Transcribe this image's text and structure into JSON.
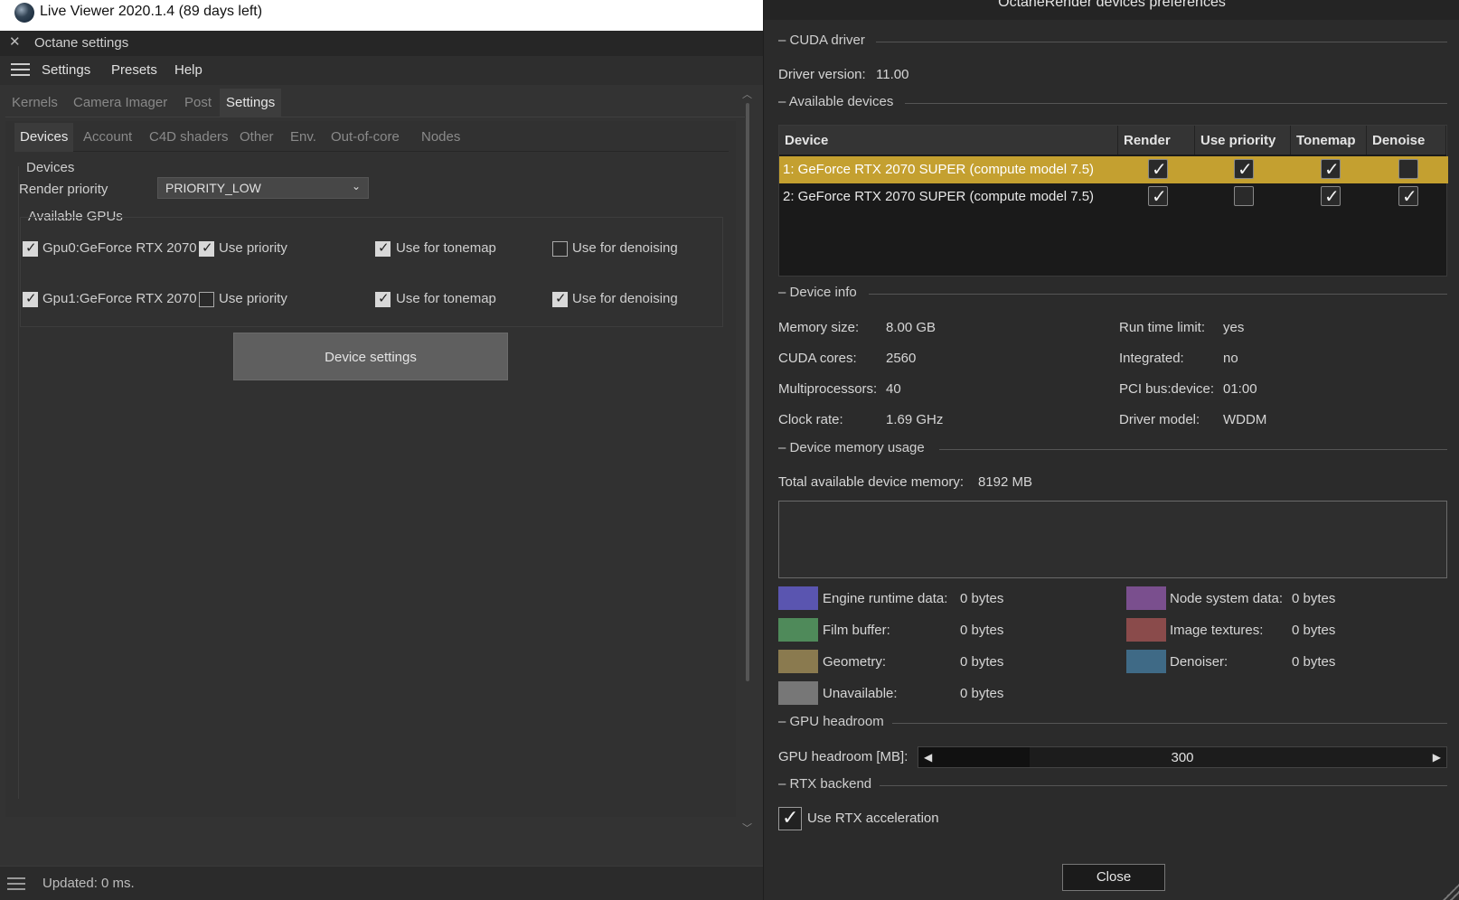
{
  "left": {
    "window_title": "Live Viewer 2020.1.4 (89 days left)",
    "panel_title": "Octane settings",
    "menu": [
      "Settings",
      "Presets",
      "Help"
    ],
    "tabs": [
      "Kernels",
      "Camera Imager",
      "Post",
      "Settings"
    ],
    "active_tab": "Settings",
    "subtabs": [
      "Devices",
      "Account",
      "C4D shaders",
      "Other",
      "Env.",
      "Out-of-core",
      "Nodes"
    ],
    "active_subtab": "Devices",
    "devices_group": "Devices",
    "render_priority_label": "Render priority",
    "render_priority_value": "PRIORITY_LOW",
    "available_gpus_label": "Available GPUs",
    "gpus": [
      {
        "name": "Gpu0:GeForce RTX 2070",
        "enabled": true,
        "use_priority": true,
        "tonemap": true,
        "denoising": false
      },
      {
        "name": "Gpu1:GeForce RTX 2070 :",
        "enabled": true,
        "use_priority": false,
        "tonemap": true,
        "denoising": true
      }
    ],
    "use_priority_label": "Use priority",
    "tonemap_label": "Use for tonemap",
    "denoising_label": "Use for denoising",
    "device_settings_button": "Device settings",
    "status": "Updated: 0 ms."
  },
  "right": {
    "title": "OctaneRender devices preferences",
    "cuda_driver_section": "CUDA driver",
    "driver_version_label": "Driver version:",
    "driver_version": "11.00",
    "available_devices_section": "Available devices",
    "table_headers": [
      "Device",
      "Render",
      "Use priority",
      "Tonemap",
      "Denoise"
    ],
    "devices": [
      {
        "name": "1: GeForce RTX 2070 SUPER (compute model 7.5)",
        "render": true,
        "priority": true,
        "tonemap": true,
        "denoise": false,
        "selected": true
      },
      {
        "name": "2: GeForce RTX 2070 SUPER (compute model 7.5)",
        "render": true,
        "priority": false,
        "tonemap": true,
        "denoise": true,
        "selected": false
      }
    ],
    "device_info_section": "Device info",
    "info_left": [
      {
        "label": "Memory size:",
        "value": "8.00 GB"
      },
      {
        "label": "CUDA cores:",
        "value": "2560"
      },
      {
        "label": "Multiprocessors:",
        "value": "40"
      },
      {
        "label": "Clock rate:",
        "value": "1.69 GHz"
      }
    ],
    "info_right": [
      {
        "label": "Run time limit:",
        "value": "yes"
      },
      {
        "label": "Integrated:",
        "value": "no"
      },
      {
        "label": "PCI bus:device:",
        "value": "01:00"
      },
      {
        "label": "Driver model:",
        "value": "WDDM"
      }
    ],
    "memory_section": "Device memory usage",
    "total_memory_label": "Total available device memory:",
    "total_memory": "8192 MB",
    "legend": [
      {
        "label": "Engine runtime data:",
        "value": "0 bytes",
        "color": "#5a55b0"
      },
      {
        "label": "Node system data:",
        "value": "0 bytes",
        "color": "#7a4f8e"
      },
      {
        "label": "Film buffer:",
        "value": "0 bytes",
        "color": "#4f8a5a"
      },
      {
        "label": "Image textures:",
        "value": "0 bytes",
        "color": "#8a4b4b"
      },
      {
        "label": "Geometry:",
        "value": "0 bytes",
        "color": "#8a7a4f"
      },
      {
        "label": "Denoiser:",
        "value": "0 bytes",
        "color": "#3f6a86"
      },
      {
        "label": "Unavailable:",
        "value": "0 bytes",
        "color": "#777777"
      }
    ],
    "headroom_section": "GPU headroom",
    "headroom_label": "GPU headroom [MB]:",
    "headroom_value": "300",
    "headroom_fraction": 0.21,
    "rtx_section": "RTX backend",
    "rtx_label": "Use RTX acceleration",
    "rtx_enabled": true,
    "close_button": "Close"
  }
}
